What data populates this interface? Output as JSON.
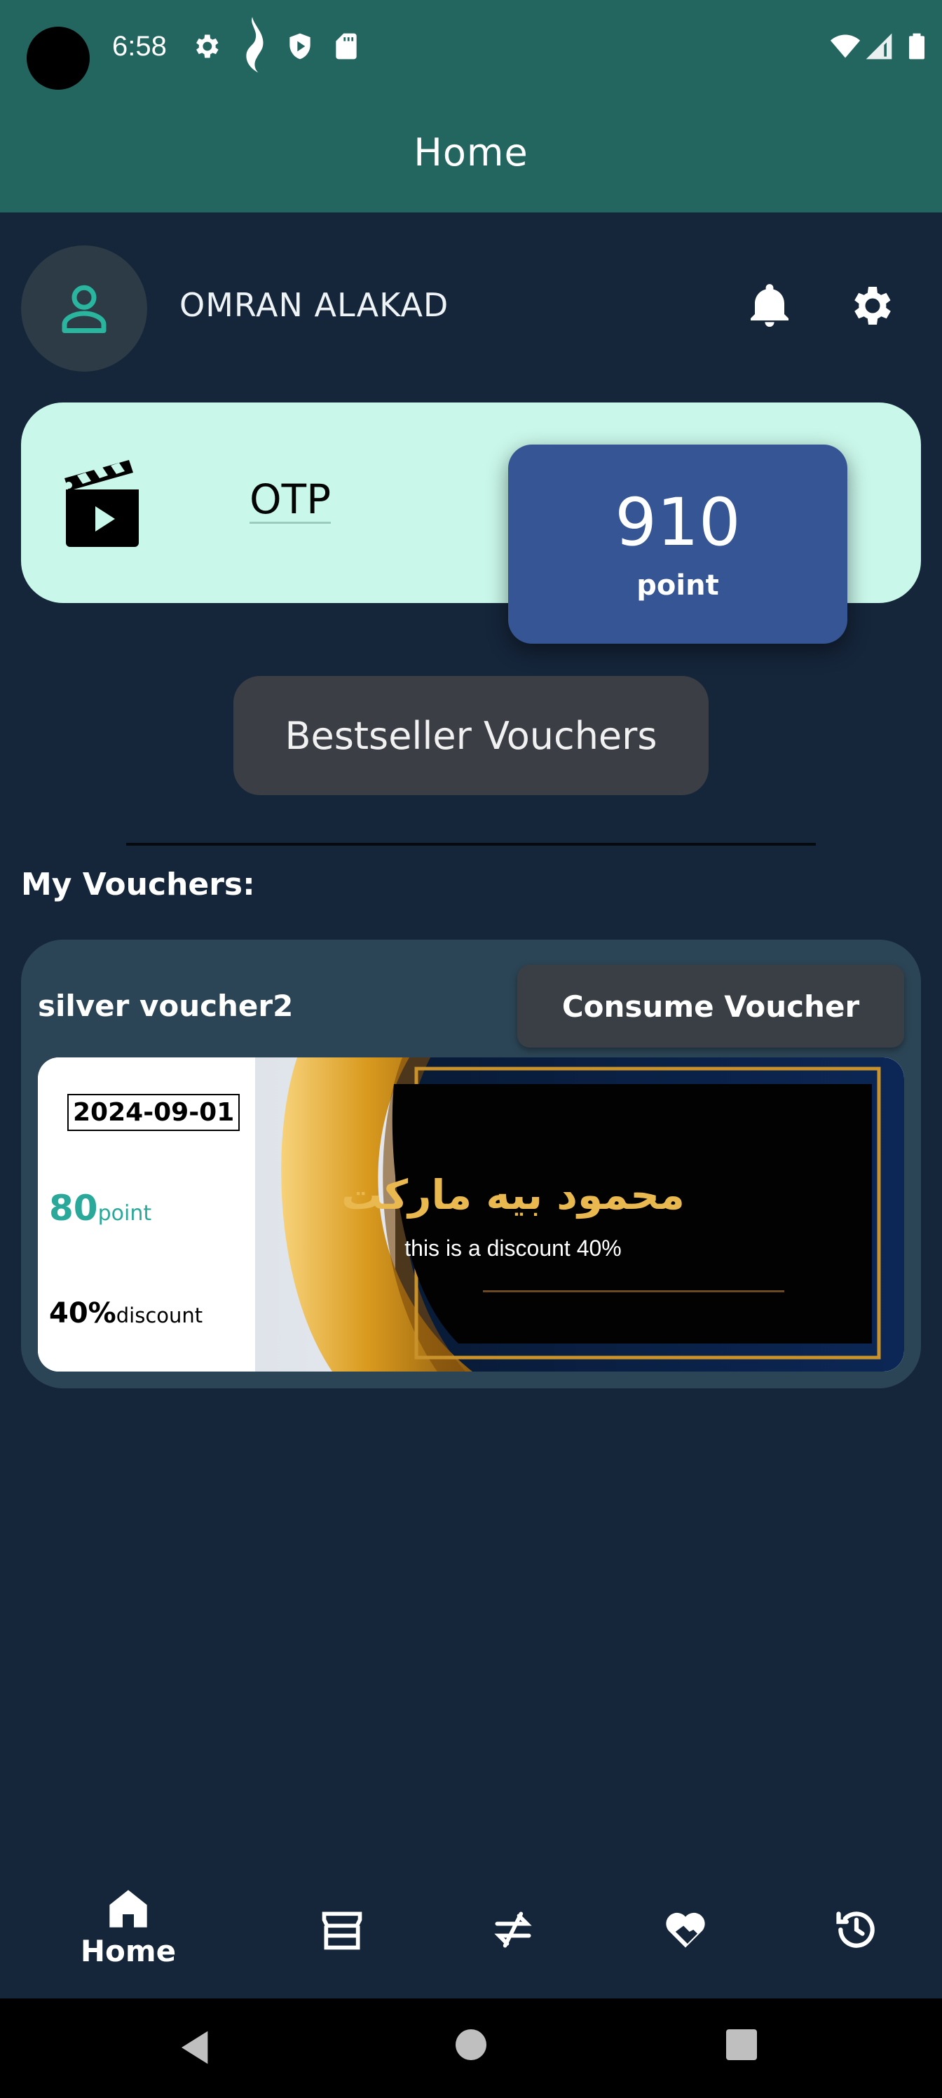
{
  "status_bar": {
    "time": "6:58"
  },
  "app_bar": {
    "title": "Home"
  },
  "profile": {
    "name": "OMRAN ALAKAD"
  },
  "balance_card": {
    "label": "OTP",
    "points": "910",
    "points_unit": "point"
  },
  "bestseller_button": "Bestseller Vouchers",
  "section_title": "My Vouchers:",
  "vouchers": [
    {
      "name": "silver voucher2",
      "action": "Consume Voucher",
      "date": "2024-09-01",
      "points": "80",
      "points_unit": "point",
      "discount": "40%",
      "discount_unit": "discount",
      "store_name": "محمود بيه ماركت",
      "description": "this is a discount 40%"
    }
  ],
  "bottom_nav": [
    {
      "label": "Home",
      "icon": "home-icon",
      "active": true
    },
    {
      "label": "",
      "icon": "store-icon"
    },
    {
      "label": "",
      "icon": "transfer-icon"
    },
    {
      "label": "",
      "icon": "heart-handshake-icon"
    },
    {
      "label": "",
      "icon": "history-icon"
    }
  ],
  "colors": {
    "app_bar": "#236660",
    "background": "#15253a",
    "card": "#c9f7ea",
    "points_box": "#355595",
    "accent": "#2aa99a"
  }
}
